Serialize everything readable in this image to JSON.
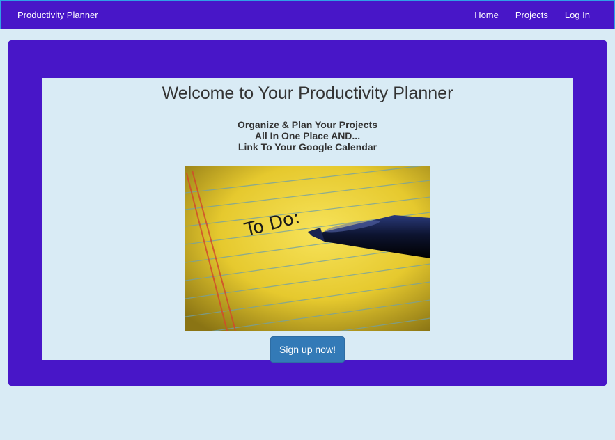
{
  "navbar": {
    "brand": "Productivity Planner",
    "links": [
      {
        "label": "Home"
      },
      {
        "label": "Projects"
      },
      {
        "label": "Log In"
      }
    ]
  },
  "hero": {
    "title": "Welcome to Your Productivity Planner",
    "tagline": [
      "Organize & Plan Your Projects",
      "All In One Place AND...",
      "Link To Your Google Calendar"
    ],
    "image_text": "To Do:",
    "cta_label": "Sign up now!"
  },
  "colors": {
    "primary": "#4816c8",
    "background": "#d9ebf5",
    "button": "#337ab7"
  }
}
